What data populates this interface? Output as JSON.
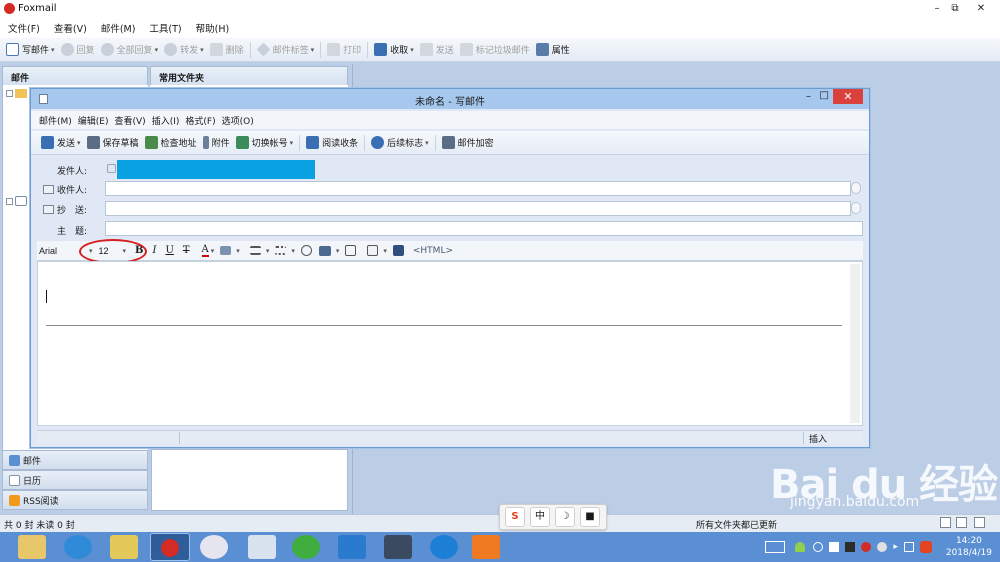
{
  "app": {
    "title": "Foxmail"
  },
  "menu": [
    "文件(F)",
    "查看(V)",
    "邮件(M)",
    "工具(T)",
    "帮助(H)"
  ],
  "toolbar": [
    {
      "label": "写邮件",
      "caret": true,
      "disabled": false,
      "color": "#4a78b8"
    },
    {
      "label": "回复",
      "caret": false,
      "disabled": true,
      "color": "#b0b8c4"
    },
    {
      "label": "全部回复",
      "caret": true,
      "disabled": true,
      "color": "#b0b8c4"
    },
    {
      "label": "转发",
      "caret": true,
      "disabled": true,
      "color": "#b0b8c4"
    },
    {
      "label": "删除",
      "caret": false,
      "disabled": true,
      "color": "#b0b8c4"
    },
    {
      "label": "邮件标签",
      "caret": true,
      "disabled": true,
      "color": "#b0b8c4"
    },
    {
      "label": "打印",
      "caret": false,
      "disabled": true,
      "color": "#b0b8c4"
    },
    {
      "label": "收取",
      "caret": true,
      "disabled": false,
      "color": "#3a6fb3"
    },
    {
      "label": "发送",
      "caret": false,
      "disabled": true,
      "color": "#b0b8c4"
    },
    {
      "label": "标记垃圾邮件",
      "caret": false,
      "disabled": true,
      "color": "#b0b8c4"
    },
    {
      "label": "属性",
      "caret": false,
      "disabled": false,
      "color": "#5a7ca8"
    }
  ],
  "panels": {
    "mail": "邮件",
    "favorites": "常用文件夹"
  },
  "nav": [
    {
      "label": "邮件",
      "icon": "mail-icon"
    },
    {
      "label": "日历",
      "icon": "calendar-icon"
    },
    {
      "label": "RSS阅读",
      "icon": "rss-icon"
    }
  ],
  "statusbar": {
    "left": "共 0 封 未读 0 封",
    "right": "所有文件夹都已更新"
  },
  "compose": {
    "title": "未命名 - 写邮件",
    "menu": [
      "邮件(M)",
      "编辑(E)",
      "查看(V)",
      "插入(I)",
      "格式(F)",
      "选项(O)"
    ],
    "toolbar": [
      {
        "label": "发送",
        "caret": true,
        "color": "#3a6fb3"
      },
      {
        "label": "保存草稿",
        "caret": false,
        "color": "#5a6d85"
      },
      {
        "label": "检查地址",
        "caret": false,
        "color": "#4a8a4a"
      },
      {
        "label": "附件",
        "caret": false,
        "color": "#6b7f9a"
      },
      {
        "label": "切换帐号",
        "caret": true,
        "color": "#3d8a5a"
      },
      {
        "label": "阅读收条",
        "caret": false,
        "color": "#3a6fb3"
      },
      {
        "label": "后续标志",
        "caret": true,
        "color": "#3a6fb3"
      },
      {
        "label": "邮件加密",
        "caret": false,
        "color": "#5a6d85"
      }
    ],
    "from_label": "发件人:",
    "from_value_color": "#0aa1e3",
    "to_label": "收件人:",
    "cc_label": "抄　送:",
    "subject_label": "主　题:",
    "font_name": "Arial",
    "font_size": "12",
    "fmt_bold": "B",
    "fmt_italic": "I",
    "fmt_underline": "U",
    "fmt_strike": "T",
    "fmt_color": "A",
    "fmt_html": "<HTML>",
    "status_mode": "插入"
  },
  "ime": {
    "zhong": "中"
  },
  "tray": {
    "time": "14:20",
    "date": "2018/4/19"
  },
  "watermark": {
    "brand": "Bai du 经验",
    "url": "jingyan.baidu.com"
  }
}
